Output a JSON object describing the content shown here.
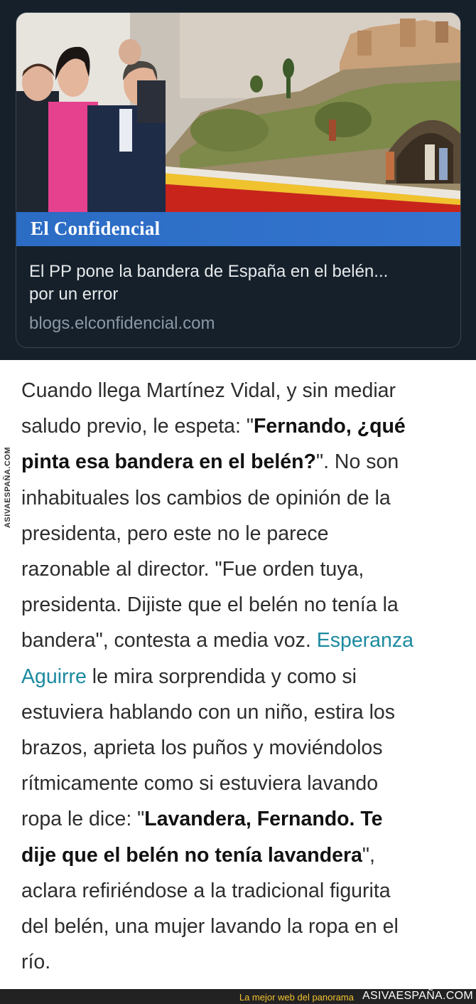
{
  "card": {
    "brand": "El Confidencial",
    "title_line1": "El PP pone la bandera de España en el belén...",
    "title_line2": "por un error",
    "url": "blogs.elconfidencial.com"
  },
  "article": {
    "l1": "Cuando llega Martínez Vidal, y sin mediar",
    "l2a": "saludo previo, le espeta: \"",
    "l2b": "Fernando, ¿qué",
    "l3a": "pinta esa bandera en el belén?",
    "l3b": "\". No son",
    "l4": "inhabituales los cambios de opinión de la",
    "l5": "presidenta, pero este no le parece",
    "l6": "razonable al director. \"Fue orden tuya,",
    "l7": "presidenta. Dijiste que el belén no tenía la",
    "l8a": "bandera\", contesta a media voz. ",
    "l8b": "Esperanza",
    "l9a": "Aguirre",
    "l9b": " le mira sorprendida y como si",
    "l10": "estuviera hablando con un niño, estira los",
    "l11": "brazos, aprieta los puños y moviéndolos",
    "l12": "rítmicamente como si estuviera lavando",
    "l13a": "ropa le dice: \"",
    "l13b": "Lavandera, Fernando. Te",
    "l14a": "dije que el belén no tenía lavandera",
    "l14b": "\",",
    "l15": "aclara refiriéndose a la tradicional figurita",
    "l16": "del belén, una mujer lavando la ropa en el",
    "l17": "río."
  },
  "watermark": {
    "side": "ASIVAESPAÑA.COM",
    "slogan": "La mejor web del panorama",
    "site": "ASIVAESPAÑA.COM"
  },
  "colors": {
    "tweet_bg": "#15202b",
    "brand_bar": "#3474cf",
    "link": "#1c8aa0",
    "slogan": "#f2c230"
  }
}
